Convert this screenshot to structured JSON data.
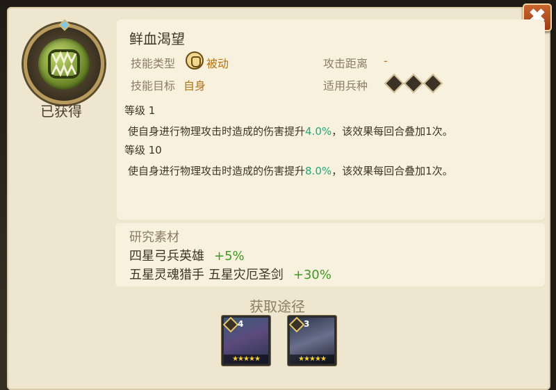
{
  "status": {
    "obtained": "已获得"
  },
  "skill": {
    "name": "鲜血渴望",
    "type_label": "技能类型",
    "type_value": "被动",
    "target_label": "技能目标",
    "target_value": "自身",
    "range_label": "攻击距离",
    "range_value": "-",
    "troops_label": "适用兵种",
    "levels": [
      {
        "title": "等级 1",
        "desc_before": "使自身进行物理攻击时造成的伤害提升",
        "value": "4.0%",
        "desc_after": "，该效果每回合叠加1次。"
      },
      {
        "title": "等级 10",
        "desc_before": "使自身进行物理攻击时造成的伤害提升",
        "value": "8.0%",
        "desc_after": "，该效果每回合叠加1次。"
      }
    ]
  },
  "materials": {
    "title": "研究素材",
    "items": [
      {
        "text": "四星弓兵英雄",
        "bonus": "+5%"
      },
      {
        "text": "五星灵魂猎手 五星灾厄圣剑",
        "bonus": "+30%"
      }
    ]
  },
  "source": {
    "title": "获取途径",
    "heroes": [
      {
        "level": "4",
        "stars": "★★★★★"
      },
      {
        "level": "3",
        "stars": "★★★★★"
      }
    ]
  },
  "icons": {
    "close": "✖",
    "skill": "fanged-mouth-icon",
    "type": "passive-skill-icon",
    "troops": [
      "sword-troop-icon",
      "fist-troop-icon",
      "bow-troop-icon"
    ]
  }
}
